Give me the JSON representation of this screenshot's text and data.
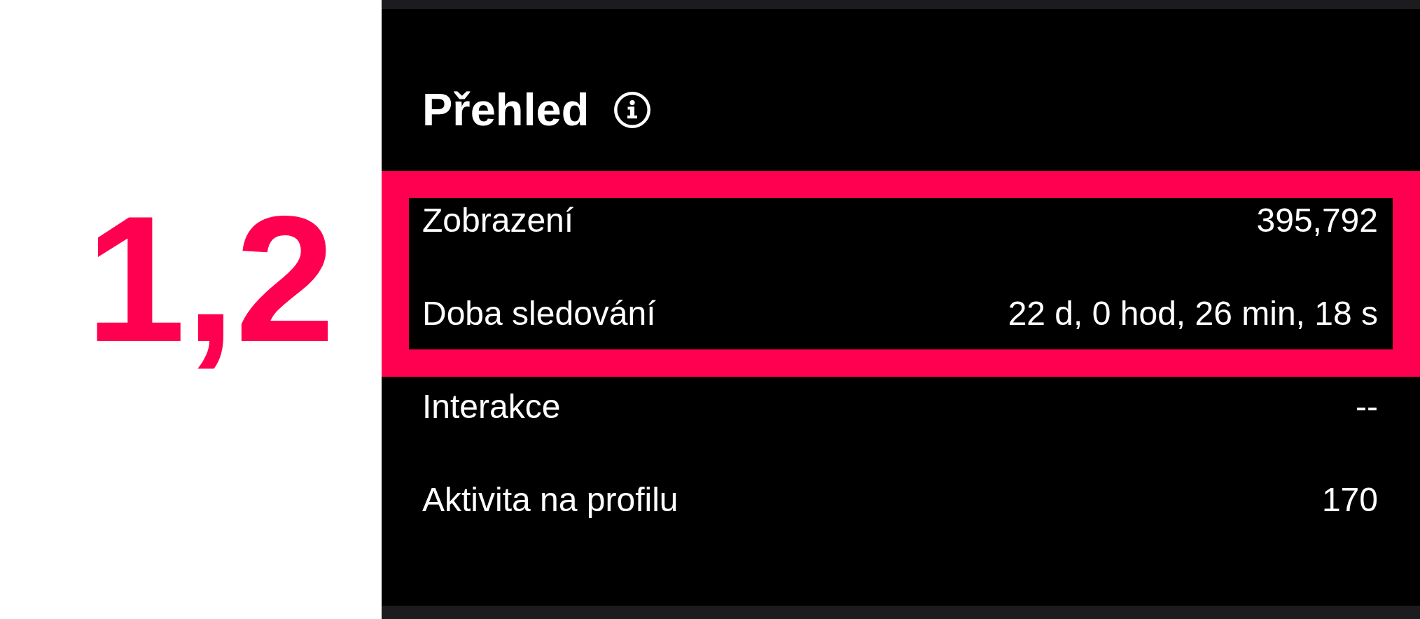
{
  "annotation": {
    "label": "1,2"
  },
  "overview": {
    "title": "Přehled",
    "stats": [
      {
        "label": "Zobrazení",
        "value": "395,792",
        "highlighted": true
      },
      {
        "label": "Doba sledování",
        "value": "22 d, 0 hod, 26 min, 18 s",
        "highlighted": true
      },
      {
        "label": "Interakce",
        "value": "--",
        "highlighted": false
      },
      {
        "label": "Aktivita na profilu",
        "value": "170",
        "highlighted": false
      }
    ]
  }
}
